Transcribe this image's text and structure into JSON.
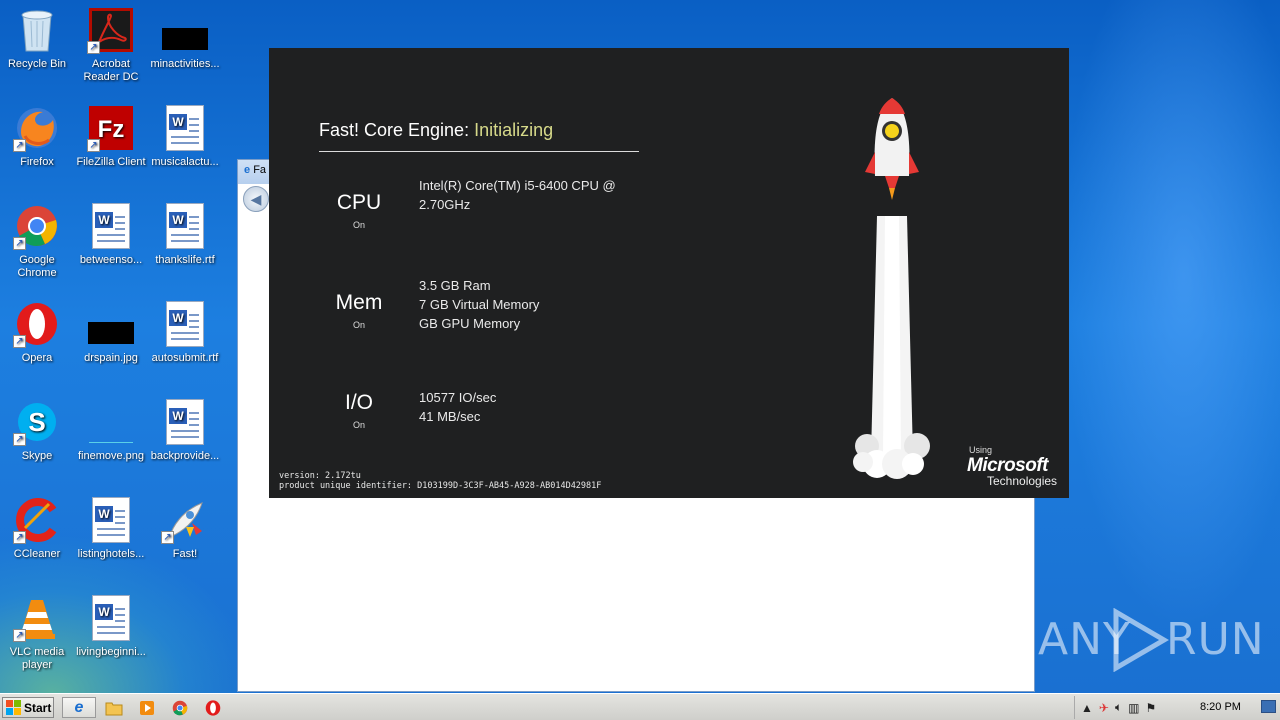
{
  "desktop": {
    "icons": [
      {
        "label": "Recycle Bin",
        "icon": "recycle-bin-icon"
      },
      {
        "label": "Acrobat Reader DC",
        "icon": "acrobat-icon"
      },
      {
        "label": "minactivities...",
        "icon": "black-file-icon"
      },
      {
        "label": "Firefox",
        "icon": "firefox-icon"
      },
      {
        "label": "FileZilla Client",
        "icon": "filezilla-icon"
      },
      {
        "label": "musicalactu...",
        "icon": "word-doc-icon"
      },
      {
        "label": "Google Chrome",
        "icon": "chrome-icon"
      },
      {
        "label": "betweenso...",
        "icon": "word-doc-icon"
      },
      {
        "label": "thankslife.rtf",
        "icon": "word-doc-icon"
      },
      {
        "label": "Opera",
        "icon": "opera-icon"
      },
      {
        "label": "drspain.jpg",
        "icon": "black-file-icon"
      },
      {
        "label": "autosubmit.rtf",
        "icon": "word-doc-icon"
      },
      {
        "label": "Skype",
        "icon": "skype-icon"
      },
      {
        "label": "finemove.png",
        "icon": "image-file-icon"
      },
      {
        "label": "backprovide...",
        "icon": "word-doc-icon"
      },
      {
        "label": "CCleaner",
        "icon": "ccleaner-icon"
      },
      {
        "label": "listinghotels...",
        "icon": "word-doc-icon"
      },
      {
        "label": "Fast!",
        "icon": "fast-rocket-icon"
      },
      {
        "label": "VLC media player",
        "icon": "vlc-icon"
      },
      {
        "label": "livingbeginni...",
        "icon": "word-doc-icon"
      }
    ]
  },
  "browser_window": {
    "title_fragment": "Fa"
  },
  "splash": {
    "title": "Fast! Core Engine:",
    "status": "Initializing",
    "cpu": {
      "name": "CPU",
      "state": "On",
      "info": [
        "Intel(R) Core(TM) i5-6400 CPU @",
        "2.70GHz"
      ]
    },
    "mem": {
      "name": "Mem",
      "state": "On",
      "info": [
        "3.5 GB Ram",
        "7 GB Virtual Memory",
        "GB GPU Memory"
      ]
    },
    "io": {
      "name": "I/O",
      "state": "On",
      "info": [
        "10577 IO/sec",
        "41 MB/sec"
      ]
    },
    "version": "version: 2.172tu",
    "product_id": "product unique identifier: D103199D-3C3F-AB45-A928-AB014D42981F",
    "branding": {
      "using": "Using",
      "company": "Microsoft",
      "suffix": "Technologies"
    }
  },
  "watermark": {
    "left": "ANY",
    "right": "RUN"
  },
  "taskbar": {
    "start_label": "Start",
    "clock": "8:20 PM",
    "pinned": [
      "ie-icon",
      "explorer-icon",
      "media-player-icon",
      "chrome-icon",
      "opera-icon"
    ]
  }
}
